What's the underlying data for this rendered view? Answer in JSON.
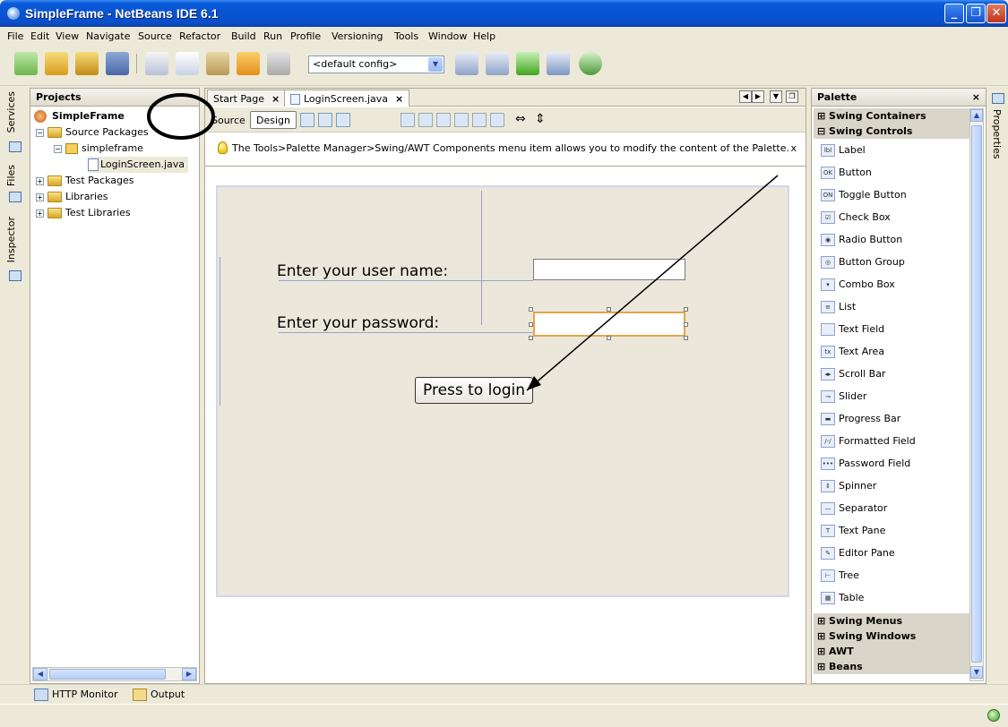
{
  "window": {
    "title": "SimpleFrame - NetBeans IDE 6.1"
  },
  "menu": [
    "File",
    "Edit",
    "View",
    "Navigate",
    "Source",
    "Refactor",
    "Build",
    "Run",
    "Profile",
    "Versioning",
    "Tools",
    "Window",
    "Help"
  ],
  "toolbar": {
    "config_value": "<default config>"
  },
  "left_tabs": {
    "services": "Services",
    "files": "Files",
    "inspector": "Inspector"
  },
  "projects": {
    "title": "Projects",
    "tree": {
      "root": "SimpleFrame",
      "source_packages": "Source Packages",
      "package": "simpleframe",
      "file": "LoginScreen.java",
      "test_packages": "Test Packages",
      "libraries": "Libraries",
      "test_libraries": "Test Libraries"
    }
  },
  "editor": {
    "tabs": [
      "Start Page",
      "LoginScreen.java"
    ],
    "source_label": "Source",
    "design_label": "Design",
    "hint": "The Tools>Palette Manager>Swing/AWT Components menu item allows you to modify the content of the Palette.",
    "hint_close": "x"
  },
  "form": {
    "username_label": "Enter your user name:",
    "password_label": "Enter your password:",
    "login_button": "Press to login"
  },
  "palette": {
    "title": "Palette",
    "categories_top": [
      "Swing Containers",
      "Swing Controls"
    ],
    "items": [
      "Label",
      "Button",
      "Toggle Button",
      "Check Box",
      "Radio Button",
      "Button Group",
      "Combo Box",
      "List",
      "Text Field",
      "Text Area",
      "Scroll Bar",
      "Slider",
      "Progress Bar",
      "Formatted Field",
      "Password Field",
      "Spinner",
      "Separator",
      "Text Pane",
      "Editor Pane",
      "Tree",
      "Table"
    ],
    "categories_bottom": [
      "Swing Menus",
      "Swing Windows",
      "AWT",
      "Beans"
    ]
  },
  "right_tabs": {
    "properties": "Properties"
  },
  "bottom": {
    "http_monitor": "HTTP Monitor",
    "output": "Output"
  },
  "colors": {
    "title_blue": "#0853d1",
    "selection_orange": "#e2a54a",
    "form_bg": "#ebe7db"
  }
}
